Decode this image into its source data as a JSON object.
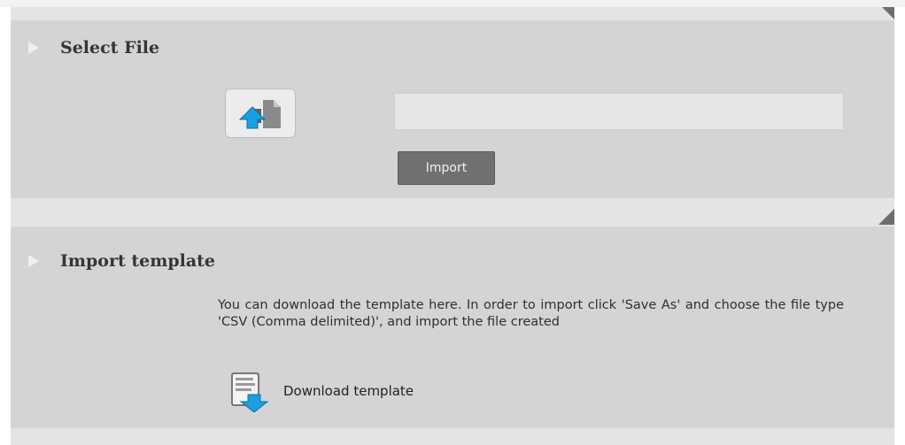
{
  "select_file": {
    "title": "Select File",
    "file_input_value": "",
    "import_label": "Import"
  },
  "import_template": {
    "title": "Import template",
    "description": "You can download the template here. In order to import click 'Save As' and choose the file type 'CSV (Comma delimited)', and import the file created",
    "download_label": "Download template"
  },
  "icons": {
    "section_marker": "triangle-right-icon",
    "upload": "upload-file-icon",
    "download": "download-document-icon"
  },
  "colors": {
    "panel_bg": "#d4d4d4",
    "band_bg": "#e4e4e4",
    "button_bg": "#707070",
    "icon_blue": "#1a9fe0"
  }
}
